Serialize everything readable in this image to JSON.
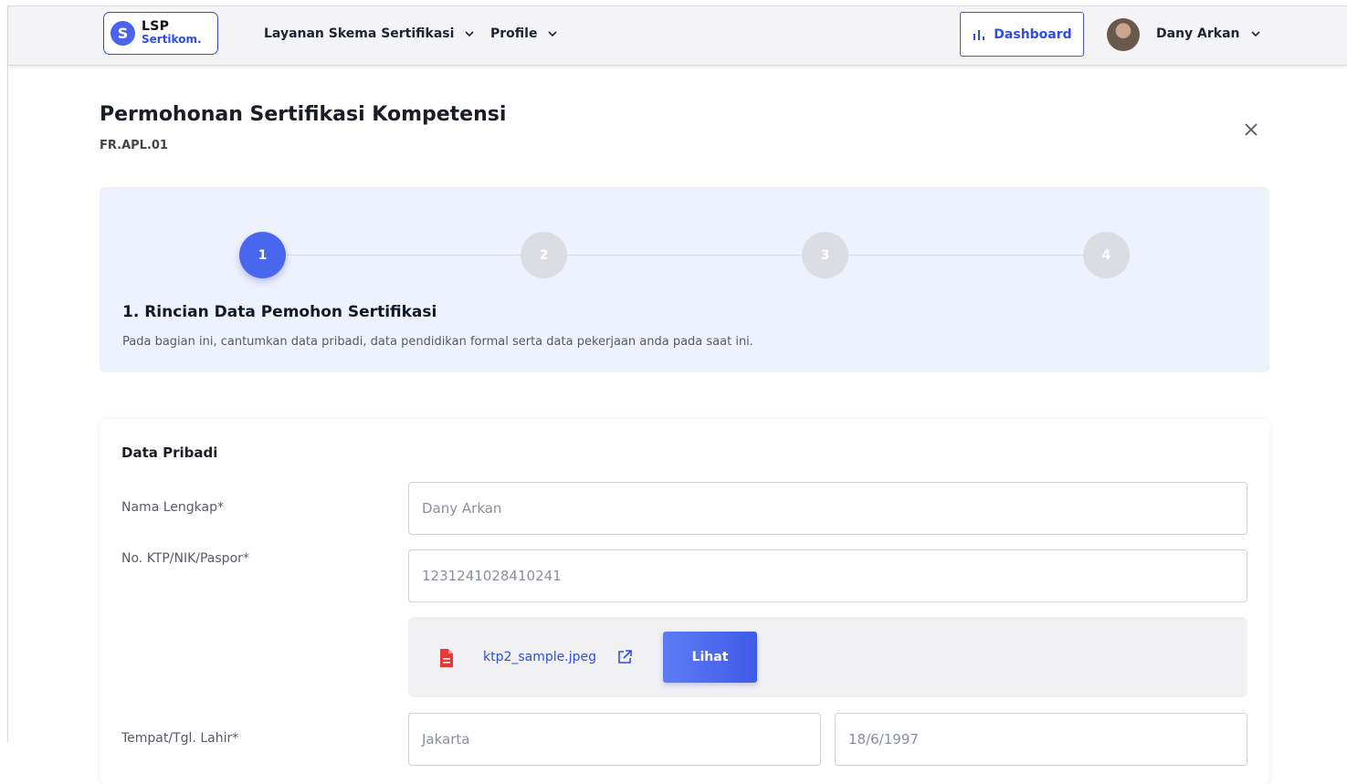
{
  "header": {
    "logo": {
      "mark": "S",
      "line1": "LSP",
      "line2": "Sertikom."
    },
    "nav": [
      {
        "label": "Layanan Skema Sertifikasi"
      },
      {
        "label": "Profile"
      }
    ],
    "dashboard_label": "Dashboard",
    "user_name": "Dany Arkan"
  },
  "page": {
    "title": "Permohonan Sertifikasi Kompetensi",
    "form_code": "FR.APL.01"
  },
  "stepper": {
    "steps": [
      "1",
      "2",
      "3",
      "4"
    ],
    "active_step": 1,
    "title": "1. Rincian Data Pemohon Sertifikasi",
    "description": "Pada bagian ini, cantumkan data pribadi, data pendidikan formal serta data pekerjaan anda pada saat ini."
  },
  "form": {
    "section_title": "Data Pribadi",
    "fields": {
      "nama": {
        "label": "Nama Lengkap*",
        "value": "Dany Arkan"
      },
      "ktp": {
        "label": "No. KTP/NIK/Paspor*",
        "value": "1231241028410241"
      },
      "ttl": {
        "label": "Tempat/Tgl. Lahir*",
        "place": "Jakarta",
        "date": "18/6/1997"
      }
    },
    "attachment": {
      "file_name": "ktp2_sample.jpeg",
      "button_label": "Lihat"
    }
  },
  "colors": {
    "accent": "#4966ef",
    "step_inactive": "#dcdde2",
    "stepper_bg": "#eef2fd",
    "file_icon": "#e53935"
  }
}
